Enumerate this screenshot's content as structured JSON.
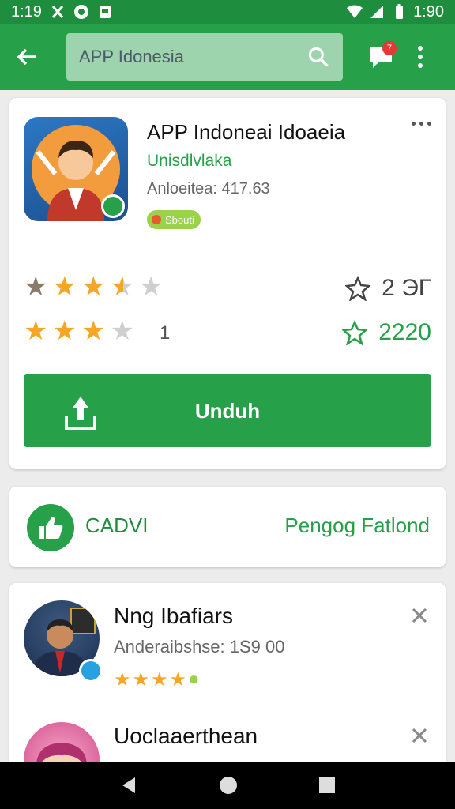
{
  "status_bar": {
    "time_left": "1:19",
    "time_right": "1:90"
  },
  "search": {
    "value": "APP Idonesia"
  },
  "notifications": {
    "badge": "7"
  },
  "app": {
    "title": "APP Indoneai Idoaeia",
    "developer": "Unisdlvlaka",
    "meta": "Anloeitea: 417.63",
    "badge": "Sbouti",
    "rating_count": "1",
    "stat_one": "2 ЭГ",
    "stat_two": "2220",
    "download_label": "Unduh"
  },
  "cadm": {
    "label": "CADVI",
    "link": "Pengog Fatlond"
  },
  "list": [
    {
      "title": "Nng Ibafiars",
      "meta": "Anderaibshse: 1S9 00"
    },
    {
      "title": "Uoclaaerthean"
    }
  ],
  "colors": {
    "primary": "#27a04a",
    "status": "#1e8e3e",
    "star": "#f5a623"
  }
}
